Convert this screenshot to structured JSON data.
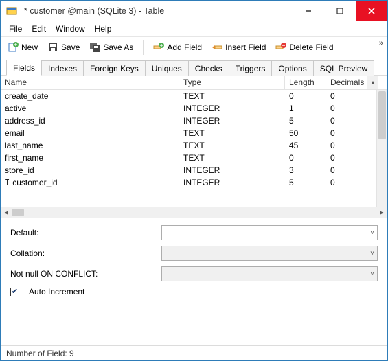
{
  "titlebar": {
    "text": "* customer @main (SQLite 3) - Table"
  },
  "menu": {
    "file": "File",
    "edit": "Edit",
    "window": "Window",
    "help": "Help"
  },
  "toolbar": {
    "new": "New",
    "save": "Save",
    "saveas": "Save As",
    "addfield": "Add Field",
    "insertfield": "Insert Field",
    "deletefield": "Delete Field"
  },
  "tabs": {
    "fields": "Fields",
    "indexes": "Indexes",
    "foreignkeys": "Foreign Keys",
    "uniques": "Uniques",
    "checks": "Checks",
    "triggers": "Triggers",
    "options": "Options",
    "sqlpreview": "SQL Preview"
  },
  "grid": {
    "head": {
      "name": "Name",
      "type": "Type",
      "length": "Length",
      "decimals": "Decimals"
    },
    "rows": [
      {
        "name": "customer_id",
        "type": "INTEGER",
        "length": "5",
        "decimals": "0",
        "cursor": true
      },
      {
        "name": "store_id",
        "type": "INTEGER",
        "length": "3",
        "decimals": "0"
      },
      {
        "name": "first_name",
        "type": "TEXT",
        "length": "0",
        "decimals": "0"
      },
      {
        "name": "last_name",
        "type": "TEXT",
        "length": "45",
        "decimals": "0"
      },
      {
        "name": "email",
        "type": "TEXT",
        "length": "50",
        "decimals": "0"
      },
      {
        "name": "address_id",
        "type": "INTEGER",
        "length": "5",
        "decimals": "0"
      },
      {
        "name": "active",
        "type": "INTEGER",
        "length": "1",
        "decimals": "0"
      },
      {
        "name": "create_date",
        "type": "TEXT",
        "length": "0",
        "decimals": "0"
      }
    ]
  },
  "form": {
    "default": "Default:",
    "collation": "Collation:",
    "notnull": "Not null ON CONFLICT:",
    "autoinc": "Auto Increment"
  },
  "status": {
    "text": "Number of Field: 9"
  }
}
